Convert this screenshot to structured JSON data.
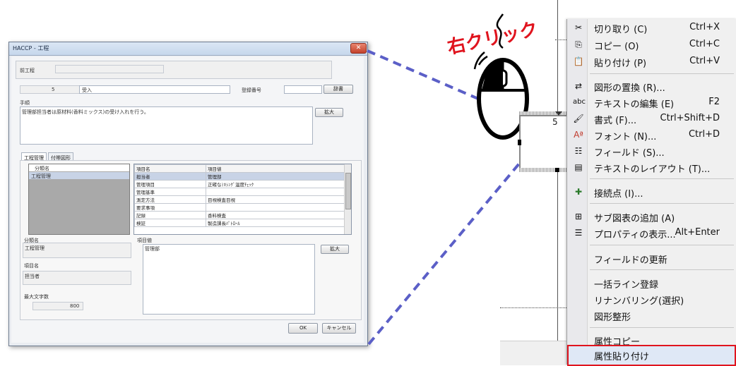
{
  "annotation": {
    "right_click_label": "右クリック"
  },
  "dialog": {
    "title": "HACCP - 工程",
    "prev_process_label": "前工程",
    "step_number": "5",
    "step_name": "受入",
    "register_number_label": "登録番号",
    "dictionary_button": "辞書",
    "procedure_label": "手順",
    "procedure_text": "管理部担当者は原材料(香料ミックス)の受け入れを行う。",
    "expand_button_1": "拡大",
    "tabs": [
      "工程管理",
      "付帯図形"
    ],
    "category_list": {
      "header": "分類名",
      "items": [
        "工程管理"
      ]
    },
    "attr_table": {
      "headers": [
        "項目名",
        "項目値"
      ],
      "rows": [
        [
          "担当者",
          "管理部"
        ],
        [
          "管理項目",
          "正確なﾐｷｼﾝｸﾞ温度ﾁｪｯｸ"
        ],
        [
          "管理基準",
          ""
        ],
        [
          "測定方法",
          "目視検査目視"
        ],
        [
          "要求事項",
          ""
        ],
        [
          "記録",
          "香料検査"
        ],
        [
          "検証",
          "製造課長ﾊﾟﾄﾛｰﾙ"
        ]
      ]
    },
    "category_name_label": "分類名",
    "category_name_value": "工程管理",
    "item_value_label": "項目値",
    "item_value_text": "管理部",
    "expand_button_2": "拡大",
    "item_name_label": "項目名",
    "item_name_value": "担当者",
    "max_chars_label": "最大文字数",
    "max_chars_value": "800",
    "ok_button": "OK",
    "cancel_button": "キャンセル"
  },
  "canvas": {
    "shape_number": "5"
  },
  "context_menu": {
    "items": [
      {
        "icon": "scissors-icon",
        "glyph": "✂",
        "label": "切り取り (C)",
        "shortcut": "Ctrl+X"
      },
      {
        "icon": "copy-icon",
        "glyph": "⎘",
        "label": "コピー (O)",
        "shortcut": "Ctrl+C"
      },
      {
        "icon": "paste-icon",
        "glyph": "📋",
        "label": "貼り付け (P)",
        "shortcut": "Ctrl+V"
      },
      {
        "icon": "replace-shape-icon",
        "glyph": "⇄",
        "label": "図形の置換 (R)...",
        "shortcut": ""
      },
      {
        "icon": "edit-text-icon",
        "glyph": "abc",
        "label": "テキストの編集 (E)",
        "shortcut": "F2"
      },
      {
        "icon": "format-icon",
        "glyph": "🖌",
        "label": "書式 (F)...",
        "shortcut": "Ctrl+Shift+D"
      },
      {
        "icon": "font-icon",
        "glyph": "Aª",
        "label": "フォント (N)...",
        "shortcut": "Ctrl+D"
      },
      {
        "icon": "field-icon",
        "glyph": "☷",
        "label": "フィールド (S)...",
        "shortcut": ""
      },
      {
        "icon": "text-layout-icon",
        "glyph": "▤",
        "label": "テキストのレイアウト (T)...",
        "shortcut": ""
      },
      {
        "icon": "connection-point-icon",
        "glyph": "✚",
        "label": "接続点 (I)...",
        "shortcut": ""
      },
      {
        "icon": "add-subdiagram-icon",
        "glyph": "⊞",
        "label": "サブ図表の追加 (A)",
        "shortcut": ""
      },
      {
        "icon": "properties-icon",
        "glyph": "☰",
        "label": "プロパティの表示...",
        "shortcut": "Alt+Enter"
      },
      {
        "icon": "",
        "glyph": "",
        "label": "フィールドの更新",
        "shortcut": ""
      },
      {
        "icon": "",
        "glyph": "",
        "label": "一括ライン登録",
        "shortcut": ""
      },
      {
        "icon": "",
        "glyph": "",
        "label": "リナンバリング(選択)",
        "shortcut": ""
      },
      {
        "icon": "",
        "glyph": "",
        "label": "図形整形",
        "shortcut": ""
      },
      {
        "icon": "",
        "glyph": "",
        "label": "属性コピー",
        "shortcut": ""
      },
      {
        "icon": "",
        "glyph": "",
        "label": "属性貼り付け",
        "shortcut": ""
      }
    ]
  }
}
